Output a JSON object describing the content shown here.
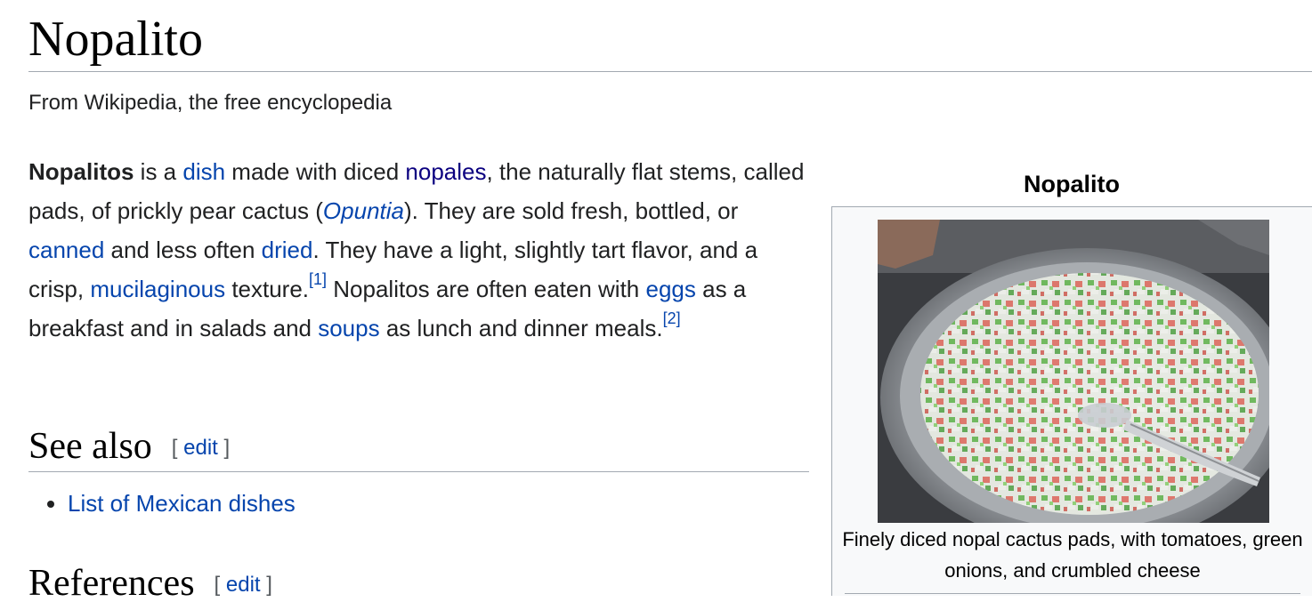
{
  "page": {
    "title": "Nopalito",
    "tagline": "From Wikipedia, the free encyclopedia"
  },
  "lead": {
    "bold_term": "Nopalitos",
    "t1": " is a ",
    "link_dish": "dish",
    "t2": " made with diced ",
    "link_nopales": "nopales",
    "t3": ", the naturally flat stems, called pads, of prickly pear cactus (",
    "link_opuntia": "Opuntia",
    "t4": "). They are sold fresh, bottled, or ",
    "link_canned": "canned",
    "t5": " and less often ",
    "link_dried": "dried",
    "t6": ". They have a light, slightly tart flavor, and a crisp, ",
    "link_mucilaginous": "mucilaginous",
    "t7": " texture.",
    "ref1": "[1]",
    "t8": " Nopalitos are often eaten with ",
    "link_eggs": "eggs",
    "t9": " as a breakfast and in salads and ",
    "link_soups": "soups",
    "t10": " as lunch and dinner meals.",
    "ref2": "[2]"
  },
  "sections": {
    "see_also": {
      "heading": "See also",
      "edit_open": "[",
      "edit_label": "edit",
      "edit_close": "]"
    },
    "references": {
      "heading": "References",
      "edit_open": "[",
      "edit_label": "edit",
      "edit_close": "]"
    }
  },
  "see_also_items": [
    "List of Mexican dishes"
  ],
  "infobox": {
    "title": "Nopalito",
    "caption": "Finely diced nopal cactus pads, with tomatoes, green onions, and crumbled cheese"
  },
  "colors": {
    "link": "#0645ad",
    "visited_link": "#0b0080",
    "text": "#202122",
    "rule": "#a2a9b1",
    "infobox_bg": "#f8f9fa"
  }
}
